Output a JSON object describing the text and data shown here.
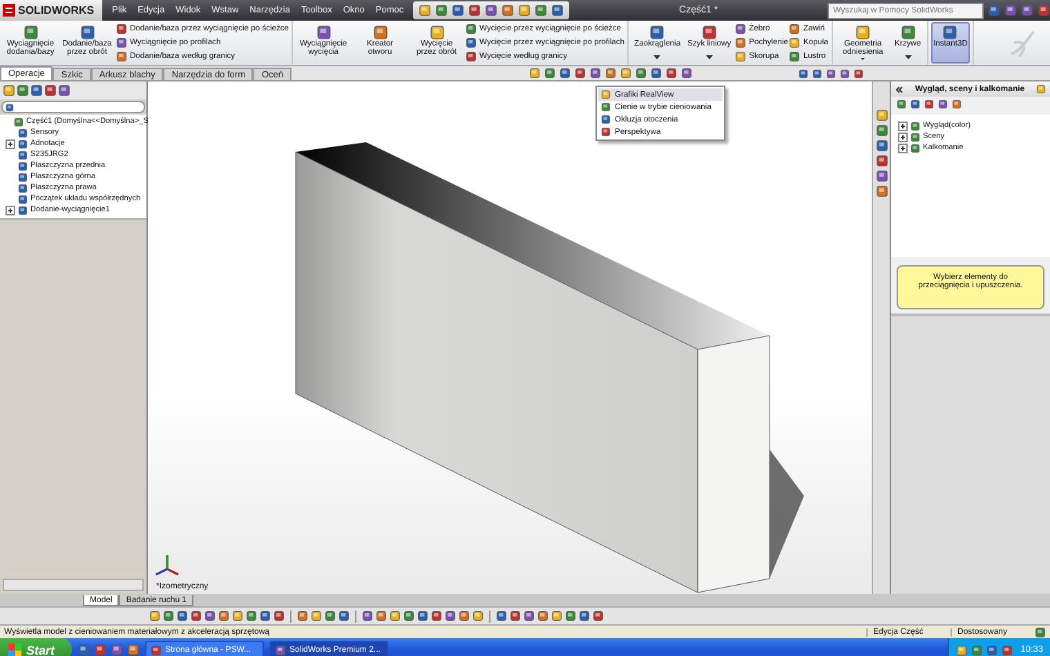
{
  "titlebar": {
    "logo": "SOLIDWORKS",
    "menu": [
      "Plik",
      "Edycja",
      "Widok",
      "Wstaw",
      "Narzędzia",
      "Toolbox",
      "Okno",
      "Pomoc"
    ],
    "title": "Część1 *",
    "search": {
      "placeholder": "Wyszukaj w Pomocy SolidWorks"
    }
  },
  "ribbon": {
    "groups": [
      {
        "items": [
          {
            "kind": "large",
            "label": "Wyciągnięcie dodania/bazy",
            "selected": false,
            "dropdown": false
          },
          {
            "kind": "large",
            "label": "Dodanie/baza przez obrót",
            "selected": false,
            "dropdown": false
          },
          {
            "kind": "stack",
            "labels": [
              "Dodanie/baza przez wyciągnięcie po ścieżce",
              "Wyciągnięcie po profilach",
              "Dodanie/baza według granicy"
            ]
          }
        ]
      },
      {
        "items": [
          {
            "kind": "large",
            "label": "Wyciągnięcie wycięcia",
            "selected": false,
            "dropdown": false
          },
          {
            "kind": "large",
            "label": "Kreator otworu",
            "selected": false,
            "dropdown": false
          },
          {
            "kind": "large",
            "label": "Wycięcie przez obrót",
            "selected": false,
            "dropdown": false
          },
          {
            "kind": "stack",
            "labels": [
              "Wycięcie przez wyciągnięcie po ścieżce",
              "Wycięcie przez wyciągnięcie po profilach",
              "Wycięcie według granicy"
            ]
          }
        ]
      },
      {
        "items": [
          {
            "kind": "large",
            "label": "Zaokrąglenia",
            "selected": false,
            "dropdown": true
          },
          {
            "kind": "large",
            "label": "Szyk liniowy",
            "selected": false,
            "dropdown": true
          },
          {
            "kind": "stack",
            "labels": [
              "Żebro",
              "Pochylenie",
              "Skorupa"
            ]
          },
          {
            "kind": "stack",
            "labels": [
              "Zawiń",
              "Kopuła",
              "Lustro"
            ]
          }
        ]
      },
      {
        "items": [
          {
            "kind": "large",
            "label": "Geometria odniesienia",
            "selected": false,
            "dropdown": true
          },
          {
            "kind": "large",
            "label": "Krzywe",
            "selected": false,
            "dropdown": true
          }
        ]
      },
      {
        "items": [
          {
            "kind": "large",
            "label": "Instant3D",
            "selected": true,
            "dropdown": false
          }
        ]
      }
    ]
  },
  "tabs": [
    {
      "label": "Operacje",
      "selected": true
    },
    {
      "label": "Szkic",
      "selected": false
    },
    {
      "label": "Arkusz blachy",
      "selected": false
    },
    {
      "label": "Narzędzia do form",
      "selected": false
    },
    {
      "label": "Oceń",
      "selected": false
    }
  ],
  "feature_tree": {
    "root": {
      "label": "Część1  (Domyślna<<Domyślna>_S",
      "expandable": false,
      "children": [
        {
          "label": "Sensory",
          "expandable": false
        },
        {
          "label": "Adnotacje",
          "expandable": true
        },
        {
          "label": "S235JRG2",
          "expandable": false
        },
        {
          "label": "Płaszczyzna przednia",
          "expandable": false
        },
        {
          "label": "Płaszczyzna górna",
          "expandable": false
        },
        {
          "label": "Płaszczyzna prawa",
          "expandable": false
        },
        {
          "label": "Początek układu współrzędnych",
          "expandable": false
        },
        {
          "label": "Dodanie-wyciągnięcie1",
          "expandable": true
        }
      ]
    }
  },
  "viewport": {
    "view_label": "*Izometryczny",
    "render_menu": [
      {
        "label": "Grafiki RealView",
        "selected": true
      },
      {
        "label": "Cienie w trybie cieniowania",
        "selected": false
      },
      {
        "label": "Okluzja otoczenia",
        "selected": false
      },
      {
        "label": "Perspektywa",
        "selected": false
      }
    ]
  },
  "task_pane": {
    "title": "Wygląd, sceny i kalkomanie",
    "items": [
      {
        "label": "Wygląd(color)",
        "expandable": true
      },
      {
        "label": "Sceny",
        "expandable": true
      },
      {
        "label": "Kalkomanie",
        "expandable": true
      }
    ],
    "hint": "Wybierz elementy do przeciągnięcia i upuszczenia."
  },
  "bottom_tabs": [
    {
      "label": "Model",
      "selected": true
    },
    {
      "label": "Badanie ruchu 1",
      "selected": false
    }
  ],
  "status_bar": {
    "message": "Wyświetla model z cieniowaniem materiałowym z akceleracją sprzętową",
    "mode": "Edycja Część",
    "units": "Dostosowany"
  },
  "taskbar": {
    "start": "Start",
    "tasks": [
      {
        "label": "Strona główna - PSW...",
        "selected": false
      },
      {
        "label": "SolidWorks Premium 2...",
        "selected": true
      }
    ],
    "clock": "10:33"
  }
}
